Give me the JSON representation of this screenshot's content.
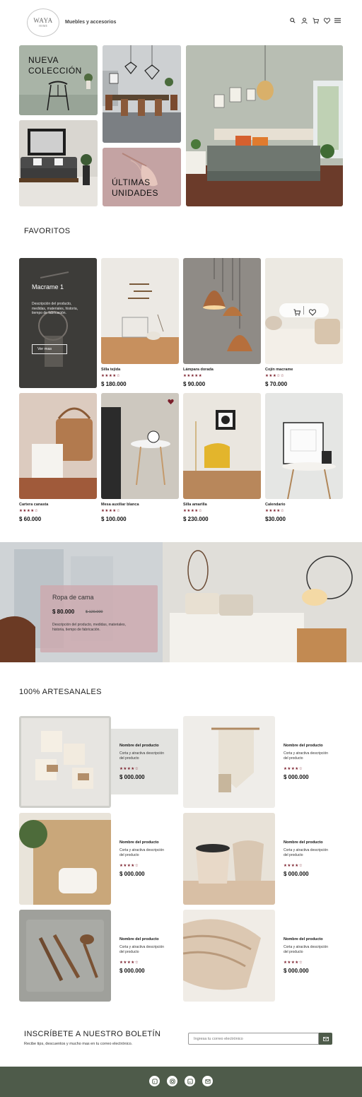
{
  "header": {
    "logo_line1": "WAYA",
    "logo_line2": "HOME",
    "brand": "Muebles y accesorios"
  },
  "hero": {
    "nueva_line1": "NUEVA",
    "nueva_line2": "COLECCIÓN",
    "ultimas_line1": "ÚLTIMAS",
    "ultimas_line2": "UNIDADES"
  },
  "favoritos": {
    "title": "FAVORITOS",
    "feature": {
      "title": "Macrame 1",
      "desc": "Descripción del producto, medidas, materiales, historia, tiempo de fabricación.",
      "button": "Ver mas"
    },
    "products": [
      {
        "name": "Silla tejida",
        "stars": "★★★★☆",
        "price": "$ 180.000"
      },
      {
        "name": "Lámpara dorada",
        "stars": "★★★★★",
        "price": "$ 90.000"
      },
      {
        "name": "Cojín macrame",
        "stars": "★★★☆☆",
        "price": "$ 70.000"
      },
      {
        "name": "Cartera canasta",
        "stars": "★★★★☆",
        "price": "$ 60.000"
      },
      {
        "name": "Mesa auxiliar blanca",
        "stars": "★★★★☆",
        "price": "$ 100.000"
      },
      {
        "name": "Silla amarilla",
        "stars": "★★★★☆",
        "price": "$ 230.000"
      },
      {
        "name": "Calendario",
        "stars": "★★★★☆",
        "price": "$30.000"
      }
    ]
  },
  "promo": {
    "title": "Ropa de cama",
    "price": "$ 80.000",
    "old_price": "$ 120.000",
    "desc": "Descripción del producto, medidas, materiales, historia, tiempo de fabricación."
  },
  "artesanales": {
    "title": "100% ARTESANALES",
    "items": [
      {
        "name": "Nombre del producto",
        "desc": "Corta y atractiva descripción del producto",
        "stars": "★★★★☆",
        "price": "$ 000.000"
      },
      {
        "name": "Nombre del producto",
        "desc": "Corta y atractiva descripción del producto",
        "stars": "★★★★☆",
        "price": "$ 000.000"
      },
      {
        "name": "Nombre del producto",
        "desc": "Corta y atractiva descripción del producto",
        "stars": "★★★★☆",
        "price": "$ 000.000"
      },
      {
        "name": "Nombre del producto",
        "desc": "Corta y atractiva descripción del producto",
        "stars": "★★★★☆",
        "price": "$ 000.000"
      },
      {
        "name": "Nombre del producto",
        "desc": "Corta y atractiva descripción del producto",
        "stars": "★★★★☆",
        "price": "$ 000.000"
      },
      {
        "name": "Nombre del producto",
        "desc": "Corta y atractiva descripción del producto",
        "stars": "★★★★☆",
        "price": "$ 000.000"
      }
    ]
  },
  "newsletter": {
    "title": "INSCRÍBETE A NUESTRO BOLETÍN",
    "subtitle": "Recibe tips, descuentos y mucho mas en tu correo electrónico.",
    "placeholder": "Ingresa tu correo electrónico"
  },
  "colors": {
    "accent_star": "#7a1f2b",
    "footer": "#4e5b4a",
    "sage": "#a9b4a7",
    "rose": "#c4a3a3"
  },
  "icons": [
    "search-icon",
    "user-icon",
    "cart-icon",
    "heart-icon",
    "menu-icon",
    "facebook-icon",
    "instagram-icon",
    "linkedin-icon",
    "mail-icon"
  ]
}
